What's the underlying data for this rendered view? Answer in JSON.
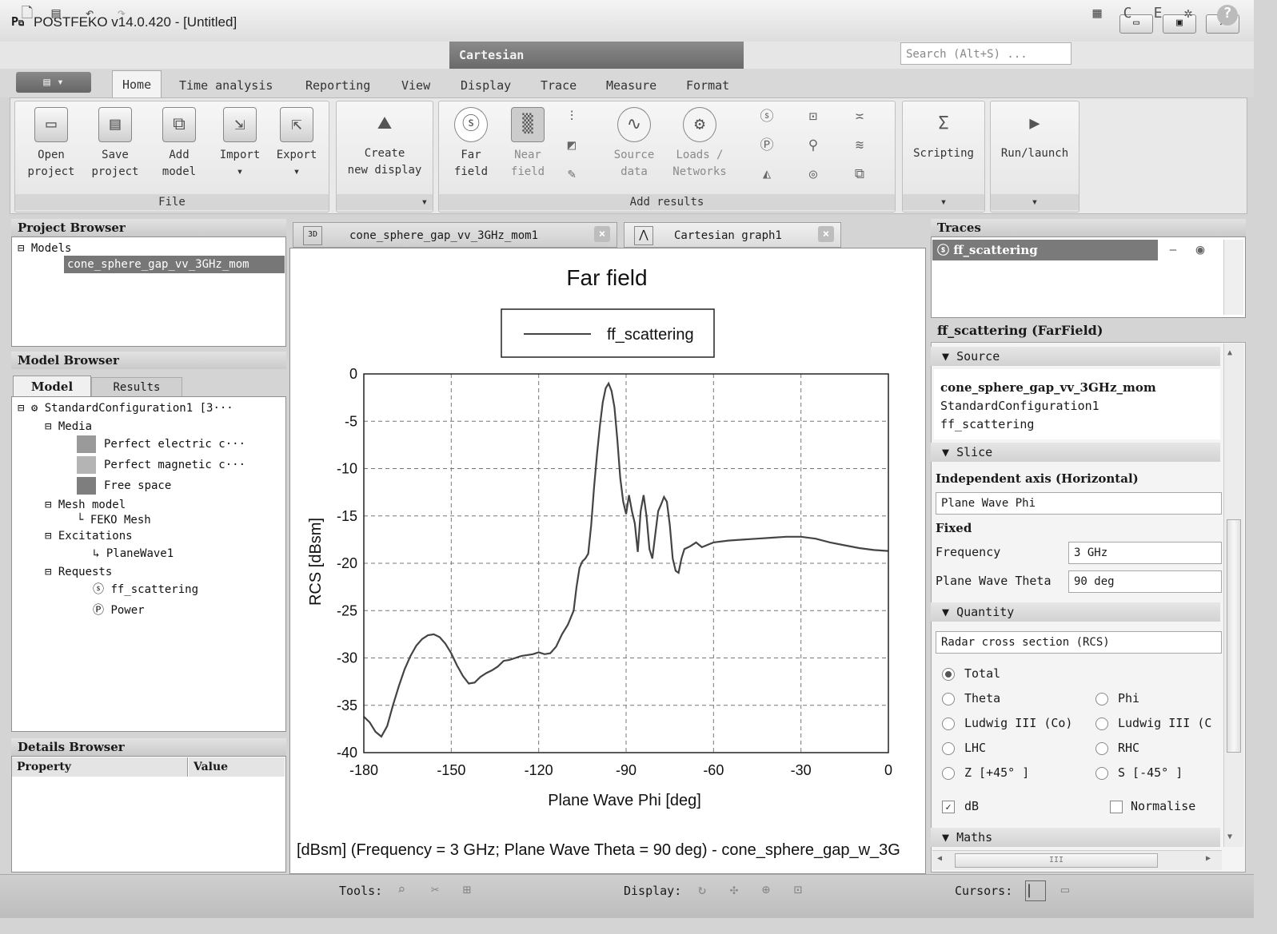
{
  "window": {
    "title": "POSTFEKO v14.0.420 - [Untitled]",
    "minimize": "▭",
    "maximize": "▣",
    "close": "✕"
  },
  "context_tab": "Cartesian",
  "search": {
    "placeholder": "Search (Alt+S) ..."
  },
  "ribbon_tabs": [
    "Home",
    "Time analysis",
    "Reporting",
    "View",
    "Display",
    "Trace",
    "Measure",
    "Format"
  ],
  "ribbon": {
    "file_group": "File",
    "open_project": [
      "Open",
      "project"
    ],
    "save_project": [
      "Save",
      "project"
    ],
    "add_model": [
      "Add",
      "model"
    ],
    "import": "Import",
    "export": "Export",
    "create_display": [
      "Create",
      "new display"
    ],
    "far_field": [
      "Far",
      "field"
    ],
    "near_field": [
      "Near",
      "field"
    ],
    "source_data": [
      "Source",
      "data"
    ],
    "loads_networks": [
      "Loads /",
      "Networks"
    ],
    "add_results_group": "Add results",
    "scripting": "Scripting",
    "run_launch": "Run/launch"
  },
  "project_browser": {
    "title": "Project Browser",
    "root": "Models",
    "model": "cone_sphere_gap_vv_3GHz_mom"
  },
  "model_browser": {
    "title": "Model Browser",
    "tabs": [
      "Model",
      "Results"
    ],
    "config": "StandardConfiguration1 [3···",
    "media_label": "Media",
    "media": [
      "Perfect electric c···",
      "Perfect magnetic c···",
      "Free space"
    ],
    "media_colors": [
      "#9a9a9a",
      "#b4b4b4",
      "#7e7e7e"
    ],
    "mesh_model": "Mesh model",
    "feko_mesh": "FEKO Mesh",
    "excitations": "Excitations",
    "planewave": "PlaneWave1",
    "requests": "Requests",
    "ff_scattering": "ff_scattering",
    "power": "Power"
  },
  "details_browser": {
    "title": "Details Browser",
    "columns": [
      "Property",
      "Value"
    ]
  },
  "doc_tabs": [
    "cone_sphere_gap_vv_3GHz_mom1",
    "Cartesian graph1"
  ],
  "chart_footer": "[dBsm] (Frequency = 3 GHz; Plane Wave Theta = 90 deg) - cone_sphere_gap_w_3G",
  "chart_data": {
    "type": "line",
    "title": "Far field",
    "xlabel": "Plane Wave Phi [deg]",
    "ylabel": "RCS [dBsm]",
    "xlim": [
      -180,
      0
    ],
    "ylim": [
      -40,
      0
    ],
    "xticks": [
      "-180",
      "-150",
      "-120",
      "-90",
      "-60",
      "-30",
      "0"
    ],
    "yticks": [
      "0",
      "-5",
      "-10",
      "-15",
      "-20",
      "-25",
      "-30",
      "-35",
      "-40"
    ],
    "grid": true,
    "legend_position": "top-center",
    "series": [
      {
        "name": "ff_scattering",
        "color": "#444444",
        "x": [
          -180,
          -178,
          -176,
          -174,
          -172,
          -170,
          -168,
          -166,
          -164,
          -162,
          -160,
          -158,
          -156,
          -154,
          -152,
          -150,
          -148,
          -146,
          -144,
          -142,
          -140,
          -138,
          -136,
          -134,
          -132,
          -130,
          -128,
          -126,
          -124,
          -122,
          -120,
          -118,
          -116,
          -114,
          -112,
          -110,
          -108,
          -107,
          -106,
          -105,
          -104,
          -103,
          -102,
          -101,
          -100,
          -99,
          -98,
          -97,
          -96,
          -95,
          -94,
          -93,
          -92,
          -91,
          -90,
          -89,
          -88,
          -87,
          -86,
          -85,
          -84,
          -83,
          -82,
          -81,
          -80,
          -79,
          -78,
          -77,
          -76,
          -75,
          -74,
          -73,
          -72,
          -71,
          -70,
          -68,
          -66,
          -64,
          -60,
          -55,
          -50,
          -45,
          -40,
          -35,
          -30,
          -25,
          -20,
          -15,
          -10,
          -5,
          0
        ],
        "y": [
          -36.2,
          -36.8,
          -37.8,
          -38.3,
          -37.2,
          -35.0,
          -33.0,
          -31.2,
          -29.8,
          -28.7,
          -28.0,
          -27.6,
          -27.5,
          -27.8,
          -28.5,
          -29.5,
          -30.8,
          -31.9,
          -32.7,
          -32.6,
          -32.0,
          -31.6,
          -31.3,
          -30.9,
          -30.3,
          -30.2,
          -30.0,
          -29.8,
          -29.7,
          -29.6,
          -29.4,
          -29.6,
          -29.5,
          -28.8,
          -27.5,
          -26.5,
          -25.0,
          -22.5,
          -20.5,
          -19.8,
          -19.5,
          -19.0,
          -16.0,
          -12.0,
          -8.5,
          -5.5,
          -3.0,
          -1.5,
          -1.0,
          -1.8,
          -3.5,
          -7.0,
          -11.0,
          -13.5,
          -14.8,
          -12.8,
          -14.5,
          -15.8,
          -18.8,
          -14.5,
          -12.8,
          -15.0,
          -18.5,
          -19.5,
          -17.0,
          -14.5,
          -13.8,
          -13.0,
          -13.5,
          -16.0,
          -19.5,
          -20.8,
          -21.0,
          -19.5,
          -18.5,
          -18.2,
          -17.8,
          -18.3,
          -17.8,
          -17.6,
          -17.5,
          -17.4,
          -17.3,
          -17.2,
          -17.2,
          -17.4,
          -17.8,
          -18.1,
          -18.4,
          -18.6,
          -18.7
        ]
      }
    ]
  },
  "traces": {
    "title": "Traces",
    "item": "ff_scattering"
  },
  "props": {
    "title": "ff_scattering (FarField)",
    "source_section": "Source",
    "source_lines": [
      "cone_sphere_gap_vv_3GHz_mom",
      "StandardConfiguration1",
      "ff_scattering"
    ],
    "slice_section": "Slice",
    "independent_axis": "Independent axis (Horizontal)",
    "axis_value": "Plane Wave Phi",
    "fixed": "Fixed",
    "frequency_label": "Frequency",
    "frequency_value": "3 GHz",
    "theta_label": "Plane Wave Theta",
    "theta_value": "90 deg",
    "quantity_section": "Quantity",
    "quantity_value": "Radar cross section (RCS)",
    "radios": [
      "Total",
      "Theta",
      "Phi",
      "Ludwig III (Co)",
      "Ludwig III (C",
      "LHC",
      "RHC",
      "Z [+45° ]",
      "S [-45° ]"
    ],
    "db": "dB",
    "normalise": "Normalise",
    "maths_section": "Maths",
    "scroll_mark": "III"
  },
  "status": {
    "tools": "Tools:",
    "display": "Display:",
    "cursors": "Cursors:"
  }
}
